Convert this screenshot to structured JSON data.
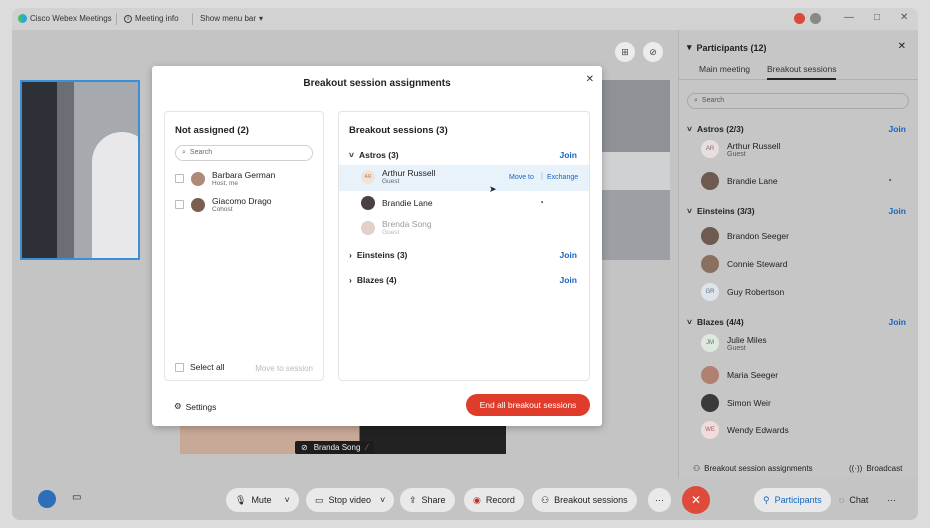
{
  "titlebar": {
    "app_name": "Cisco Webex Meetings",
    "meeting_info": "Meeting info",
    "show_menu_bar": "Show menu bar",
    "minimize": "—",
    "maximize": "□",
    "close": "✕"
  },
  "stage": {
    "video_name": "Branda Song"
  },
  "panel": {
    "title": "Participants (12)",
    "close": "✕",
    "tabs": [
      {
        "label": "Main meeting"
      },
      {
        "label": "Breakout sessions"
      }
    ],
    "search_placeholder": "Search",
    "groups": [
      {
        "name": "Astros (2/3)",
        "join": "Join",
        "people": [
          {
            "name": "Arthur Russell",
            "sub": "Guest",
            "initials": "AR"
          },
          {
            "name": "Brandie Lane",
            "sub": ""
          }
        ]
      },
      {
        "name": "Einsteins (3/3)",
        "join": "Join",
        "people": [
          {
            "name": "Brandon Seeger",
            "sub": ""
          },
          {
            "name": "Connie Steward",
            "sub": ""
          },
          {
            "name": "Guy Robertson",
            "sub": "",
            "initials": "GR"
          }
        ]
      },
      {
        "name": "Blazes (4/4)",
        "join": "Join",
        "people": [
          {
            "name": "Julie Miles",
            "sub": "Guest",
            "initials": "JM"
          },
          {
            "name": "Maria Seeger",
            "sub": ""
          },
          {
            "name": "Simon Weir",
            "sub": ""
          },
          {
            "name": "Wendy Edwards",
            "sub": "",
            "initials": "WE"
          }
        ]
      }
    ],
    "footer_assign": "Breakout session assignments",
    "footer_broadcast": "Broadcast"
  },
  "toolbar": {
    "mute": "Mute",
    "stop_video": "Stop video",
    "share": "Share",
    "record": "Record",
    "breakout": "Breakout sessions",
    "more": "···",
    "participants": "Participants",
    "chat": "Chat",
    "more2": "···"
  },
  "modal": {
    "title": "Breakout session assignments",
    "close": "✕",
    "not_assigned_title": "Not assigned (2)",
    "search_placeholder": "Search",
    "unassigned": [
      {
        "name": "Barbara German",
        "sub": "Host, me"
      },
      {
        "name": "Giacomo Drago",
        "sub": "Cohost"
      }
    ],
    "select_all": "Select all",
    "move_to_session": "Move to session",
    "sessions_title": "Breakout sessions (3)",
    "sessions": [
      {
        "name": "Astros (3)",
        "join": "Join",
        "expanded": true
      },
      {
        "name": "Einsteins (3)",
        "join": "Join",
        "expanded": false
      },
      {
        "name": "Blazes (4)",
        "join": "Join",
        "expanded": false
      }
    ],
    "astros_members": [
      {
        "name": "Arthur Russell",
        "sub": "Guest",
        "initials": "AR",
        "move_to": "Move to",
        "exchange": "Exchange"
      },
      {
        "name": "Brandie Lane",
        "sub": ""
      },
      {
        "name": "Brenda Song",
        "sub": "Guest"
      }
    ],
    "settings": "Settings",
    "end_all": "End all breakout sessions"
  },
  "colors": {
    "accent_blue": "#1565c0",
    "end_red": "#e03c2c",
    "highlight": "#e8f2fb"
  }
}
